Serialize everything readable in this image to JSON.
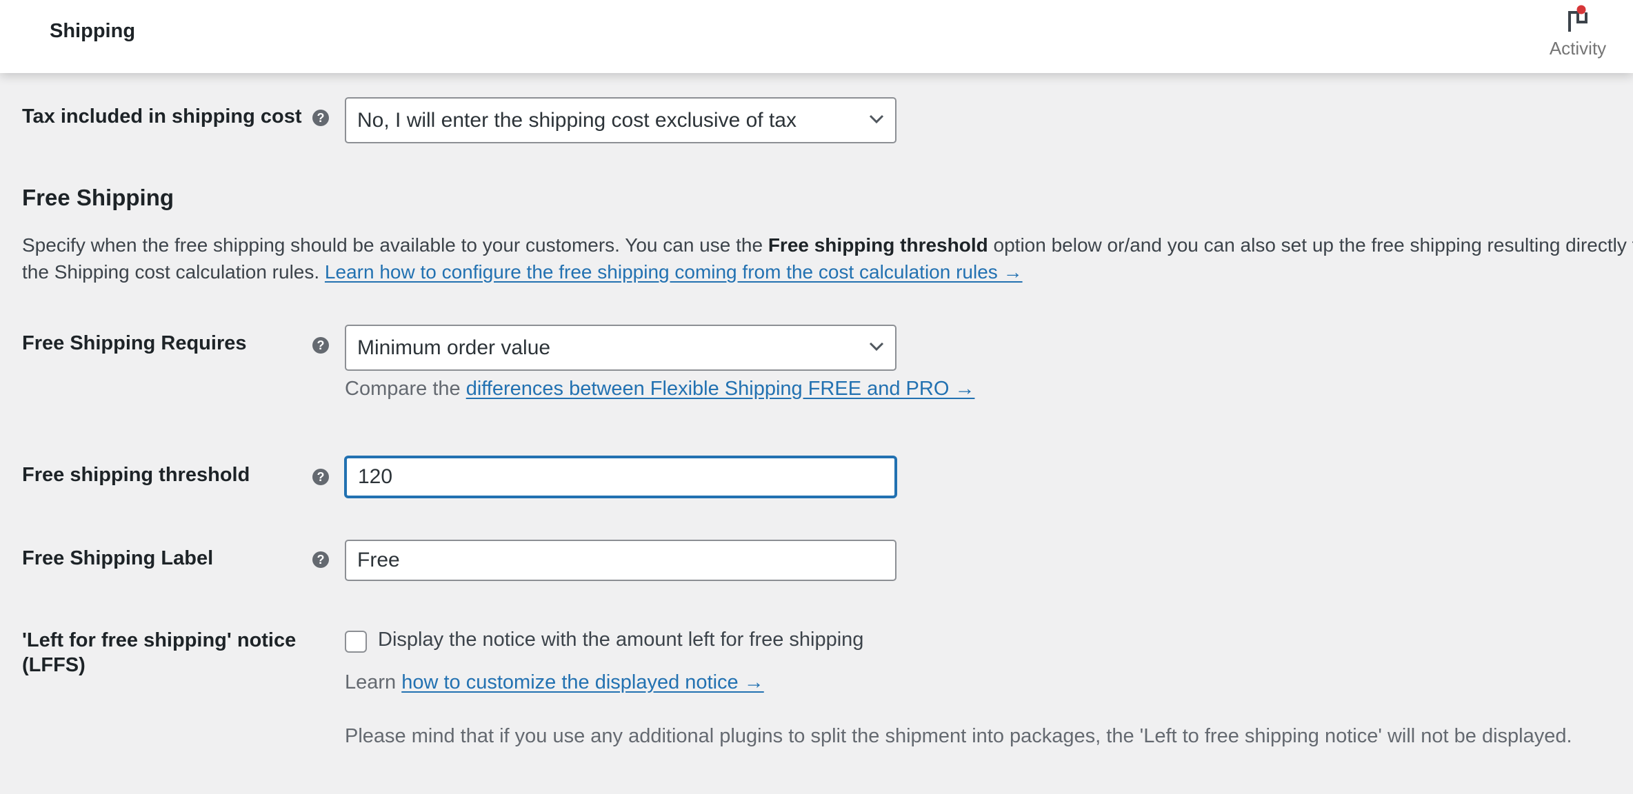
{
  "header": {
    "title": "Shipping",
    "activity_label": "Activity",
    "activity_icon": "flag-icon",
    "activity_badge_color": "#d63638"
  },
  "tax": {
    "label": "Tax included in shipping cost",
    "value": "No, I will enter the shipping cost exclusive of tax"
  },
  "free_shipping": {
    "section_title": "Free Shipping",
    "description_pre": "Specify when the free shipping should be available to your customers. You can use the ",
    "description_bold": "Free shipping threshold",
    "description_post": " option below or/and you can also set up the free shipping resulting directly from the Shipping cost calculation rules. ",
    "description_link": "Learn how to configure the free shipping coming from the cost calculation rules →"
  },
  "requires": {
    "label": "Free Shipping Requires",
    "value": "Minimum order value",
    "compare_pre": "Compare the ",
    "compare_link": "differences between Flexible Shipping FREE and PRO →"
  },
  "threshold": {
    "label": "Free shipping threshold",
    "value": "120"
  },
  "shipping_label": {
    "label": "Free Shipping Label",
    "value": "Free"
  },
  "lffs": {
    "label_line1": "'Left for free shipping' notice",
    "label_line2": "(LFFS)",
    "checkbox_label": "Display the notice with the amount left for free shipping",
    "checked": false,
    "learn_pre": "Learn ",
    "learn_link": "how to customize the displayed notice →",
    "note": "Please mind that if you use any additional plugins to split the shipment into packages, the 'Left to free shipping notice' will not be displayed."
  },
  "help_glyph": "?",
  "colors": {
    "link": "#2271b1",
    "focus": "#2271b1",
    "background": "#f0f0f1"
  }
}
